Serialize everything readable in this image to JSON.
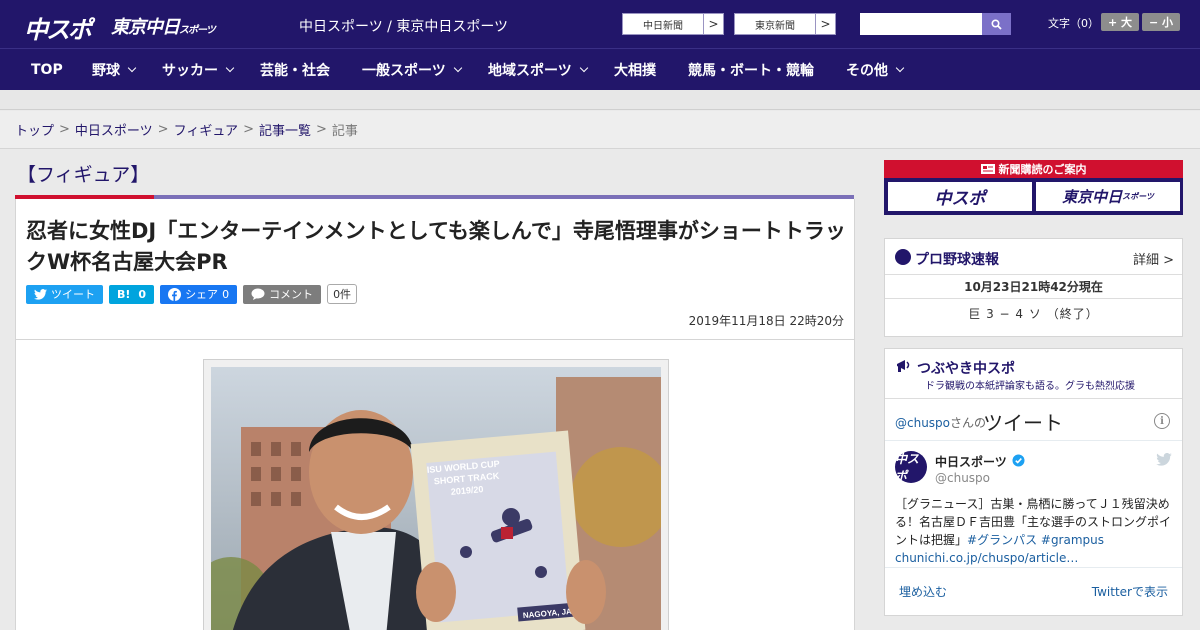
{
  "header": {
    "logo_chuspo": "中スポ",
    "logo_tokyo": "東京中日",
    "logo_tokyo_suffix": "スポーツ",
    "site_title": "中日スポーツ / 東京中日スポーツ",
    "ext_links": [
      {
        "label": "中日新聞",
        "arrow": ">"
      },
      {
        "label": "東京新聞",
        "arrow": ">"
      }
    ],
    "search_placeholder": "",
    "font_size_label": "文字（0）",
    "font_plus": "+ 大",
    "font_minus": "− 小"
  },
  "nav": {
    "items": [
      {
        "label": "TOP",
        "dropdown": false
      },
      {
        "label": "野球",
        "dropdown": true
      },
      {
        "label": "サッカー",
        "dropdown": true
      },
      {
        "label": "芸能・社会",
        "dropdown": false
      },
      {
        "label": "一般スポーツ",
        "dropdown": true
      },
      {
        "label": "地域スポーツ",
        "dropdown": true
      },
      {
        "label": "大相撲",
        "dropdown": false
      },
      {
        "label": "競馬・ボート・競輪",
        "dropdown": false
      },
      {
        "label": "その他",
        "dropdown": true
      }
    ]
  },
  "breadcrumb": {
    "items": [
      "トップ",
      "中日スポーツ",
      "フィギュア",
      "記事一覧"
    ],
    "separator": ">",
    "current": "記事"
  },
  "article": {
    "category": "【フィギュア】",
    "headline": "忍者に女性DJ「エンターテインメントとしても楽しんで」寺尾悟理事がショートトラックW杯名古屋大会PR",
    "share": {
      "tweet": "ツイート",
      "hatena": "B!",
      "hatena_count": "0",
      "facebook": "シェア",
      "facebook_count": "0",
      "comment": "コメント",
      "comment_count": "0件"
    },
    "date": "2019年11月18日 22時20分",
    "photo": {
      "poster_line1": "ISU WORLD CUP",
      "poster_line2": "SHORT TRACK",
      "poster_line3": "2019/20",
      "poster_footer": "NAGOYA, JAPAN"
    }
  },
  "sidebar": {
    "promo": {
      "title": "新聞購読のご案内",
      "left": "中スポ",
      "right": "東京中日",
      "right_suffix": "スポーツ"
    },
    "baseball": {
      "title": "プロ野球速報",
      "detail": "詳細 >",
      "updated": "10月23日21時42分現在",
      "score": "巨 3 − 4 ソ （終了）"
    },
    "twitter": {
      "title": "つぶやき中スポ",
      "subtitle": "ドラ観戦の本紙評論家も語る。グラも熱烈応援",
      "handle": "@chuspo",
      "handle_suffix": "さんの",
      "heading": "ツイート",
      "info": "i",
      "tweet_name": "中日スポーツ",
      "tweet_user": "@chuspo",
      "avatar_text": "中スポ",
      "tweet_text": "［グラニュース］古巣・鳥栖に勝ってＪ１残留決める！名古屋ＤＦ吉田豊「主な選手のストロングポイントは把握」",
      "tweet_tags": "#グランパス #grampus",
      "tweet_link": "chunichi.co.jp/chuspo/article…",
      "embed": "埋め込む",
      "view": "Twitterで表示"
    }
  },
  "colors": {
    "brand_navy": "#22166a",
    "accent_red": "#d0102f",
    "twitter_blue": "#1da1f2",
    "facebook_blue": "#1877f2",
    "hatena_blue": "#00a4de"
  }
}
